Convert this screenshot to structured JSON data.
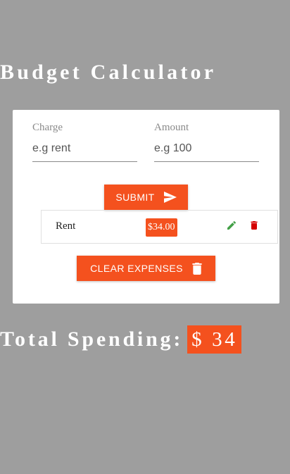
{
  "app": {
    "title": "Budget Calculator"
  },
  "form": {
    "charge": {
      "label": "Charge",
      "placeholder": "e.g rent",
      "value": ""
    },
    "amount": {
      "label": "Amount",
      "placeholder": "e.g 100",
      "value": ""
    },
    "submit_label": "SUBMIT",
    "submit_icon": "send-icon"
  },
  "expenses": [
    {
      "name": "Rent",
      "amount": "$34.00",
      "edit_icon": "pencil-icon",
      "delete_icon": "trash-icon"
    }
  ],
  "clear": {
    "label": "CLEAR EXPENSES",
    "icon": "trash-icon"
  },
  "total": {
    "label": "Total Spending:",
    "amount": "$ 34"
  },
  "colors": {
    "background": "#9e9e9e",
    "accent": "#f4511e",
    "edit": "#43a047",
    "delete": "#d50000"
  }
}
